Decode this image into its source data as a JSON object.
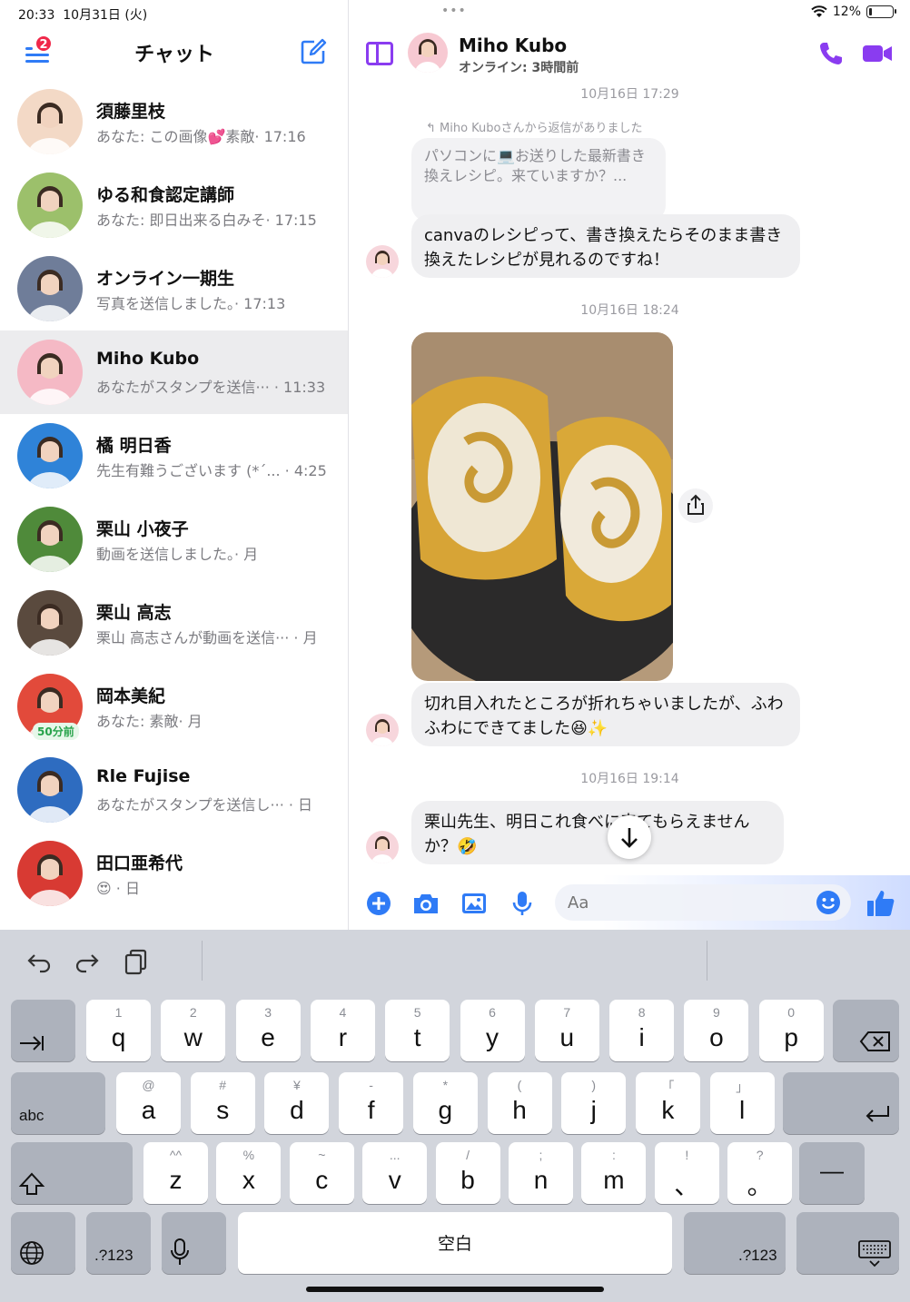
{
  "status_bar": {
    "time": "20:33",
    "date": "10月31日 (火)",
    "battery": "12%",
    "battery_level": 0.12
  },
  "left": {
    "title": "チャット",
    "unread_badge": "2",
    "chats": [
      {
        "name": "須藤里枝",
        "preview": "あなた: この画像💕素敵· 17:16",
        "avatar_color": "#f3d9c6"
      },
      {
        "name": "ゆる和食認定講師",
        "preview": "あなた: 即日出来る白みそ· 17:15",
        "avatar_color": "#9cc06b"
      },
      {
        "name": "オンライン一期生",
        "preview": "写真を送信しました。· 17:13",
        "avatar_color": "#6f7d99"
      },
      {
        "name": "Miho Kubo",
        "preview": "あなたがスタンプを送信··· · 11:33",
        "avatar_color": "#f5b9c5"
      },
      {
        "name": "橘 明日香",
        "preview": "先生有難うございます (*´... · 4:25",
        "avatar_color": "#2f83d8"
      },
      {
        "name": "栗山 小夜子",
        "preview": "動画を送信しました。· 月",
        "avatar_color": "#4f8a3a"
      },
      {
        "name": "栗山 高志",
        "preview": "栗山 高志さんが動画を送信··· · 月",
        "avatar_color": "#5a4a3e"
      },
      {
        "name": "岡本美紀",
        "preview": "あなた: 素敵· 月",
        "avatar_color": "#e24a3b",
        "time_ago": "50分前"
      },
      {
        "name": "Rle Fujise",
        "preview": "あなたがスタンプを送信し··· · 日",
        "avatar_color": "#2e6cc0"
      },
      {
        "name": "田口亜希代",
        "preview": "😍 · 日",
        "avatar_color": "#d83a33"
      }
    ]
  },
  "right": {
    "contact_name": "Miho Kubo",
    "contact_status": "オンライン: 3時間前",
    "timestamps": [
      "10月16日 17:29",
      "10月16日 18:24",
      "10月16日 19:14"
    ],
    "reply_note": "Miho Kuboさんから返信がありました",
    "quoted_text": "パソコンに💻お送りした最新書き換えレシピ。来ていますか？...",
    "messages": [
      "canvaのレシピって、書き換えたらそのまま書き換えたレシピが見れるのですね！",
      "切れ目入れたところが折れちゃいましたが、ふわふわにできてました😆✨",
      "栗山先生、明日これ食べに来てもらえませんか？🤣"
    ],
    "input_placeholder": "Aa"
  },
  "keyboard": {
    "row1": [
      [
        "1",
        "q"
      ],
      [
        "2",
        "w"
      ],
      [
        "3",
        "e"
      ],
      [
        "4",
        "r"
      ],
      [
        "5",
        "t"
      ],
      [
        "6",
        "y"
      ],
      [
        "7",
        "u"
      ],
      [
        "8",
        "i"
      ],
      [
        "9",
        "o"
      ],
      [
        "0",
        "p"
      ]
    ],
    "row2": [
      [
        "@",
        "a"
      ],
      [
        "#",
        "s"
      ],
      [
        "¥",
        "d"
      ],
      [
        "-",
        "f"
      ],
      [
        "*",
        "g"
      ],
      [
        "(",
        "h"
      ],
      [
        ")",
        "j"
      ],
      [
        "「",
        "k"
      ],
      [
        "」",
        "l"
      ]
    ],
    "row3": [
      [
        "^^",
        "z"
      ],
      [
        "%",
        "x"
      ],
      [
        "~",
        "c"
      ],
      [
        "...",
        "v"
      ],
      [
        "/",
        "b"
      ],
      [
        ";",
        "n"
      ],
      [
        ":",
        "m"
      ],
      [
        "!",
        "、"
      ],
      [
        "?",
        "。"
      ]
    ],
    "abc_label": "abc",
    "numbers_label": ".?123",
    "space_label": "空白",
    "dash_label": "―"
  },
  "colors": {
    "accent": "#8a3cf0",
    "blue": "#2f7bf6",
    "badge": "#f0284a"
  }
}
